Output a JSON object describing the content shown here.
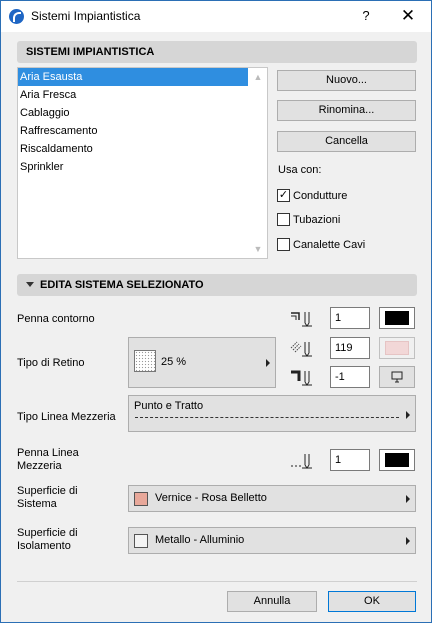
{
  "window": {
    "title": "Sistemi Impiantistica",
    "help": "?",
    "close": "✕"
  },
  "section1": {
    "title": "SISTEMI IMPIANTISTICA"
  },
  "systems": [
    "Aria Esausta",
    "Aria Fresca",
    "Cablaggio",
    "Raffrescamento",
    "Riscaldamento",
    "Sprinkler"
  ],
  "selected_system": "Aria Esausta",
  "buttons": {
    "new": "Nuovo...",
    "rename": "Rinomina...",
    "delete": "Cancella",
    "cancel": "Annulla",
    "ok": "OK"
  },
  "usa_con": {
    "label": "Usa con:",
    "options": [
      {
        "label": "Condutture",
        "checked": true
      },
      {
        "label": "Tubazioni",
        "checked": false
      },
      {
        "label": "Canalette Cavi",
        "checked": false
      }
    ]
  },
  "section2": {
    "title": "EDITA SISTEMA SELEZIONATO"
  },
  "penna_contorno": {
    "label": "Penna contorno",
    "value": "1",
    "color": "#000000"
  },
  "tipo_retino": {
    "label": "Tipo di Retino",
    "pattern": "25 %",
    "fg_pen": "119",
    "fg_color": "#f2d7d7",
    "bg_pen": "-1"
  },
  "tipo_linea": {
    "label": "Tipo Linea Mezzeria",
    "value": "Punto e Tratto"
  },
  "penna_linea": {
    "label_line1": "Penna Linea",
    "label_line2": "Mezzeria",
    "value": "1",
    "color": "#000000"
  },
  "superficie_sistema": {
    "label_line1": "Superficie di",
    "label_line2": "Sistema",
    "value": "Vernice - Rosa Belletto",
    "color": "#e8a89a"
  },
  "superficie_isolamento": {
    "label_line1": "Superficie di",
    "label_line2": "Isolamento",
    "value": "Metallo - Alluminio",
    "color": "#f4f4f4"
  }
}
